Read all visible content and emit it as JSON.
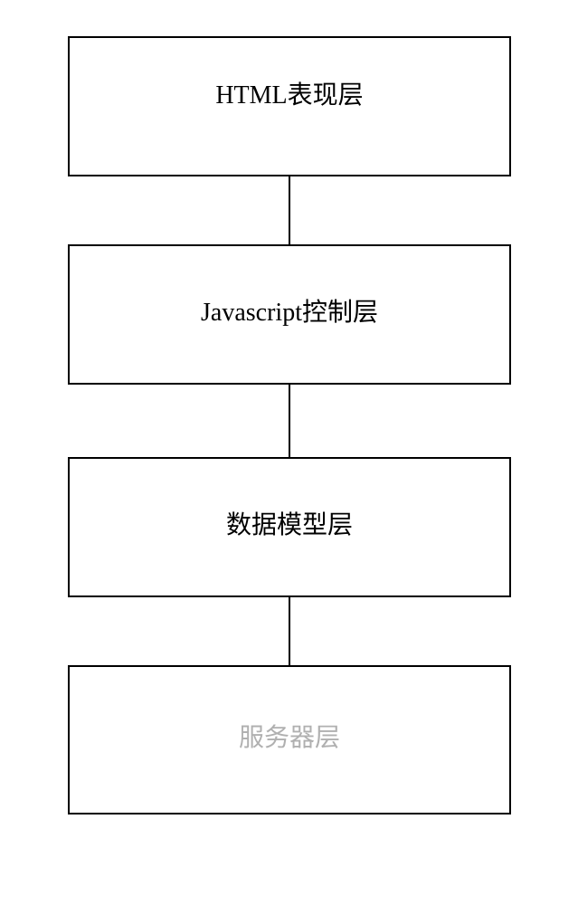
{
  "chart_data": {
    "type": "diagram",
    "title": "",
    "layers": [
      {
        "name": "HTML表现层",
        "faded": false
      },
      {
        "name": "Javascript控制层",
        "faded": false
      },
      {
        "name": "数据模型层",
        "faded": false
      },
      {
        "name": "服务器层",
        "faded": true
      }
    ]
  }
}
